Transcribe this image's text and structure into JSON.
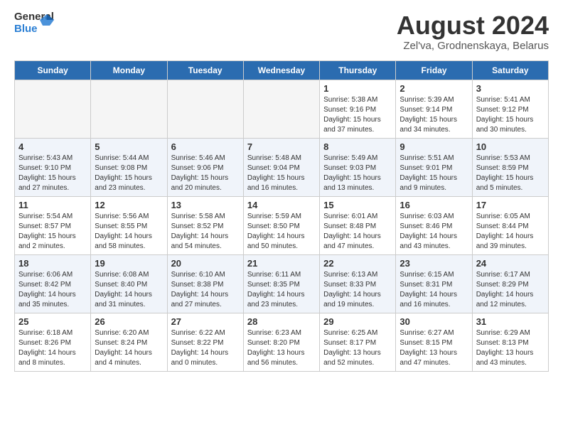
{
  "header": {
    "logo": {
      "general": "General",
      "blue": "Blue"
    },
    "title": "August 2024",
    "subtitle": "Zel'va, Grodnenskaya, Belarus"
  },
  "days_of_week": [
    "Sunday",
    "Monday",
    "Tuesday",
    "Wednesday",
    "Thursday",
    "Friday",
    "Saturday"
  ],
  "weeks": [
    {
      "alt": false,
      "days": [
        {
          "num": "",
          "content": "",
          "empty": true
        },
        {
          "num": "",
          "content": "",
          "empty": true
        },
        {
          "num": "",
          "content": "",
          "empty": true
        },
        {
          "num": "",
          "content": "",
          "empty": true
        },
        {
          "num": "1",
          "content": "Sunrise: 5:38 AM\nSunset: 9:16 PM\nDaylight: 15 hours\nand 37 minutes.",
          "empty": false
        },
        {
          "num": "2",
          "content": "Sunrise: 5:39 AM\nSunset: 9:14 PM\nDaylight: 15 hours\nand 34 minutes.",
          "empty": false
        },
        {
          "num": "3",
          "content": "Sunrise: 5:41 AM\nSunset: 9:12 PM\nDaylight: 15 hours\nand 30 minutes.",
          "empty": false
        }
      ]
    },
    {
      "alt": true,
      "days": [
        {
          "num": "4",
          "content": "Sunrise: 5:43 AM\nSunset: 9:10 PM\nDaylight: 15 hours\nand 27 minutes.",
          "empty": false
        },
        {
          "num": "5",
          "content": "Sunrise: 5:44 AM\nSunset: 9:08 PM\nDaylight: 15 hours\nand 23 minutes.",
          "empty": false
        },
        {
          "num": "6",
          "content": "Sunrise: 5:46 AM\nSunset: 9:06 PM\nDaylight: 15 hours\nand 20 minutes.",
          "empty": false
        },
        {
          "num": "7",
          "content": "Sunrise: 5:48 AM\nSunset: 9:04 PM\nDaylight: 15 hours\nand 16 minutes.",
          "empty": false
        },
        {
          "num": "8",
          "content": "Sunrise: 5:49 AM\nSunset: 9:03 PM\nDaylight: 15 hours\nand 13 minutes.",
          "empty": false
        },
        {
          "num": "9",
          "content": "Sunrise: 5:51 AM\nSunset: 9:01 PM\nDaylight: 15 hours\nand 9 minutes.",
          "empty": false
        },
        {
          "num": "10",
          "content": "Sunrise: 5:53 AM\nSunset: 8:59 PM\nDaylight: 15 hours\nand 5 minutes.",
          "empty": false
        }
      ]
    },
    {
      "alt": false,
      "days": [
        {
          "num": "11",
          "content": "Sunrise: 5:54 AM\nSunset: 8:57 PM\nDaylight: 15 hours\nand 2 minutes.",
          "empty": false
        },
        {
          "num": "12",
          "content": "Sunrise: 5:56 AM\nSunset: 8:55 PM\nDaylight: 14 hours\nand 58 minutes.",
          "empty": false
        },
        {
          "num": "13",
          "content": "Sunrise: 5:58 AM\nSunset: 8:52 PM\nDaylight: 14 hours\nand 54 minutes.",
          "empty": false
        },
        {
          "num": "14",
          "content": "Sunrise: 5:59 AM\nSunset: 8:50 PM\nDaylight: 14 hours\nand 50 minutes.",
          "empty": false
        },
        {
          "num": "15",
          "content": "Sunrise: 6:01 AM\nSunset: 8:48 PM\nDaylight: 14 hours\nand 47 minutes.",
          "empty": false
        },
        {
          "num": "16",
          "content": "Sunrise: 6:03 AM\nSunset: 8:46 PM\nDaylight: 14 hours\nand 43 minutes.",
          "empty": false
        },
        {
          "num": "17",
          "content": "Sunrise: 6:05 AM\nSunset: 8:44 PM\nDaylight: 14 hours\nand 39 minutes.",
          "empty": false
        }
      ]
    },
    {
      "alt": true,
      "days": [
        {
          "num": "18",
          "content": "Sunrise: 6:06 AM\nSunset: 8:42 PM\nDaylight: 14 hours\nand 35 minutes.",
          "empty": false
        },
        {
          "num": "19",
          "content": "Sunrise: 6:08 AM\nSunset: 8:40 PM\nDaylight: 14 hours\nand 31 minutes.",
          "empty": false
        },
        {
          "num": "20",
          "content": "Sunrise: 6:10 AM\nSunset: 8:38 PM\nDaylight: 14 hours\nand 27 minutes.",
          "empty": false
        },
        {
          "num": "21",
          "content": "Sunrise: 6:11 AM\nSunset: 8:35 PM\nDaylight: 14 hours\nand 23 minutes.",
          "empty": false
        },
        {
          "num": "22",
          "content": "Sunrise: 6:13 AM\nSunset: 8:33 PM\nDaylight: 14 hours\nand 19 minutes.",
          "empty": false
        },
        {
          "num": "23",
          "content": "Sunrise: 6:15 AM\nSunset: 8:31 PM\nDaylight: 14 hours\nand 16 minutes.",
          "empty": false
        },
        {
          "num": "24",
          "content": "Sunrise: 6:17 AM\nSunset: 8:29 PM\nDaylight: 14 hours\nand 12 minutes.",
          "empty": false
        }
      ]
    },
    {
      "alt": false,
      "days": [
        {
          "num": "25",
          "content": "Sunrise: 6:18 AM\nSunset: 8:26 PM\nDaylight: 14 hours\nand 8 minutes.",
          "empty": false
        },
        {
          "num": "26",
          "content": "Sunrise: 6:20 AM\nSunset: 8:24 PM\nDaylight: 14 hours\nand 4 minutes.",
          "empty": false
        },
        {
          "num": "27",
          "content": "Sunrise: 6:22 AM\nSunset: 8:22 PM\nDaylight: 14 hours\nand 0 minutes.",
          "empty": false
        },
        {
          "num": "28",
          "content": "Sunrise: 6:23 AM\nSunset: 8:20 PM\nDaylight: 13 hours\nand 56 minutes.",
          "empty": false
        },
        {
          "num": "29",
          "content": "Sunrise: 6:25 AM\nSunset: 8:17 PM\nDaylight: 13 hours\nand 52 minutes.",
          "empty": false
        },
        {
          "num": "30",
          "content": "Sunrise: 6:27 AM\nSunset: 8:15 PM\nDaylight: 13 hours\nand 47 minutes.",
          "empty": false
        },
        {
          "num": "31",
          "content": "Sunrise: 6:29 AM\nSunset: 8:13 PM\nDaylight: 13 hours\nand 43 minutes.",
          "empty": false
        }
      ]
    }
  ]
}
